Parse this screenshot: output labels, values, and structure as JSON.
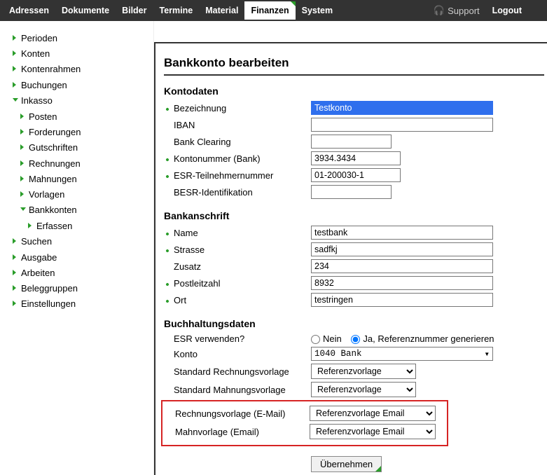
{
  "topnav": [
    "Adressen",
    "Dokumente",
    "Bilder",
    "Termine",
    "Material",
    "Finanzen",
    "System"
  ],
  "topnav_active": "Finanzen",
  "support_label": "Support",
  "logout_label": "Logout",
  "sidebar": {
    "items": [
      {
        "label": "Perioden"
      },
      {
        "label": "Konten"
      },
      {
        "label": "Kontenrahmen"
      },
      {
        "label": "Buchungen"
      },
      {
        "label": "Inkasso",
        "open": true,
        "children": [
          {
            "label": "Posten"
          },
          {
            "label": "Forderungen"
          },
          {
            "label": "Gutschriften"
          },
          {
            "label": "Rechnungen"
          },
          {
            "label": "Mahnungen"
          },
          {
            "label": "Vorlagen"
          },
          {
            "label": "Bankkonten",
            "open": true,
            "children": [
              {
                "label": "Erfassen"
              }
            ]
          }
        ]
      },
      {
        "label": "Suchen"
      },
      {
        "label": "Ausgabe"
      },
      {
        "label": "Arbeiten"
      },
      {
        "label": "Beleggruppen"
      },
      {
        "label": "Einstellungen"
      }
    ]
  },
  "main": {
    "title": "Bankkonto bearbeiten",
    "sections": {
      "kontodaten": {
        "title": "Kontodaten",
        "bezeichnung_label": "Bezeichnung",
        "bezeichnung_value": "Testkonto",
        "iban_label": "IBAN",
        "iban_value": "",
        "clearing_label": "Bank Clearing",
        "clearing_value": "",
        "kontonr_label": "Kontonummer (Bank)",
        "kontonr_value": "3934.3434",
        "esr_label": "ESR-Teilnehmernummer",
        "esr_value": "01-200030-1",
        "besr_label": "BESR-Identifikation",
        "besr_value": ""
      },
      "bankanschrift": {
        "title": "Bankanschrift",
        "name_label": "Name",
        "name_value": "testbank",
        "strasse_label": "Strasse",
        "strasse_value": "sadfkj",
        "zusatz_label": "Zusatz",
        "zusatz_value": "234",
        "plz_label": "Postleitzahl",
        "plz_value": "8932",
        "ort_label": "Ort",
        "ort_value": "testringen"
      },
      "buch": {
        "title": "Buchhaltungsdaten",
        "esrverw_label": "ESR verwenden?",
        "esrverw_nein": "Nein",
        "esrverw_ja": "Ja, Referenznummer generieren",
        "esrverw_checked": "ja",
        "konto_label": "Konto",
        "konto_value": "1040 Bank",
        "std_rechn_label": "Standard Rechnungsvorlage",
        "std_rechn_value": "Referenzvorlage",
        "std_mahn_label": "Standard Mahnungsvorlage",
        "std_mahn_value": "Referenzvorlage",
        "email_rechn_label": "Rechnungsvorlage (E-Mail)",
        "email_rechn_value": "Referenzvorlage Email",
        "email_mahn_label": "Mahnvorlage (Email)",
        "email_mahn_value": "Referenzvorlage Email"
      },
      "submit_label": "Übernehmen"
    }
  }
}
